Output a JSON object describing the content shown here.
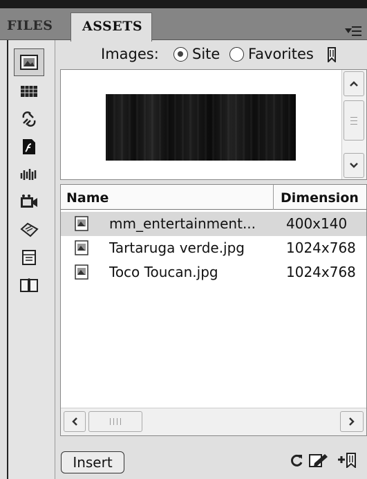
{
  "tabs": [
    {
      "label": "FILES",
      "active": false
    },
    {
      "label": "ASSETS",
      "active": true
    }
  ],
  "panel_menu_icon": "panel-options-icon",
  "categories": [
    {
      "name": "images",
      "icon": "images-icon",
      "selected": true
    },
    {
      "name": "colors",
      "icon": "colors-icon",
      "selected": false
    },
    {
      "name": "urls",
      "icon": "urls-icon",
      "selected": false
    },
    {
      "name": "swf",
      "icon": "flash-icon",
      "selected": false
    },
    {
      "name": "shockwave",
      "icon": "shockwave-icon",
      "selected": false
    },
    {
      "name": "movies",
      "icon": "movies-icon",
      "selected": false
    },
    {
      "name": "scripts",
      "icon": "scripts-icon",
      "selected": false
    },
    {
      "name": "templates",
      "icon": "templates-icon",
      "selected": false
    },
    {
      "name": "library",
      "icon": "library-icon",
      "selected": false
    }
  ],
  "images_filter": {
    "label": "Images:",
    "options": [
      {
        "label": "Site",
        "selected": true
      },
      {
        "label": "Favorites",
        "selected": false
      }
    ]
  },
  "columns": {
    "name": "Name",
    "dimensions": "Dimension"
  },
  "files": [
    {
      "name": "mm_entertainment...",
      "dimensions": "400x140",
      "selected": true
    },
    {
      "name": "Tartaruga verde.jpg",
      "dimensions": "1024x768",
      "selected": false
    },
    {
      "name": "Toco Toucan.jpg",
      "dimensions": "1024x768",
      "selected": false
    }
  ],
  "bottom": {
    "insert_label": "Insert",
    "tools": [
      "refresh-icon",
      "edit-icon",
      "add-to-favorites-icon"
    ]
  },
  "colors": {
    "panel_bg": "#e0e0e0",
    "tab_bar": "#858585",
    "selection": "#d8d8d8"
  }
}
